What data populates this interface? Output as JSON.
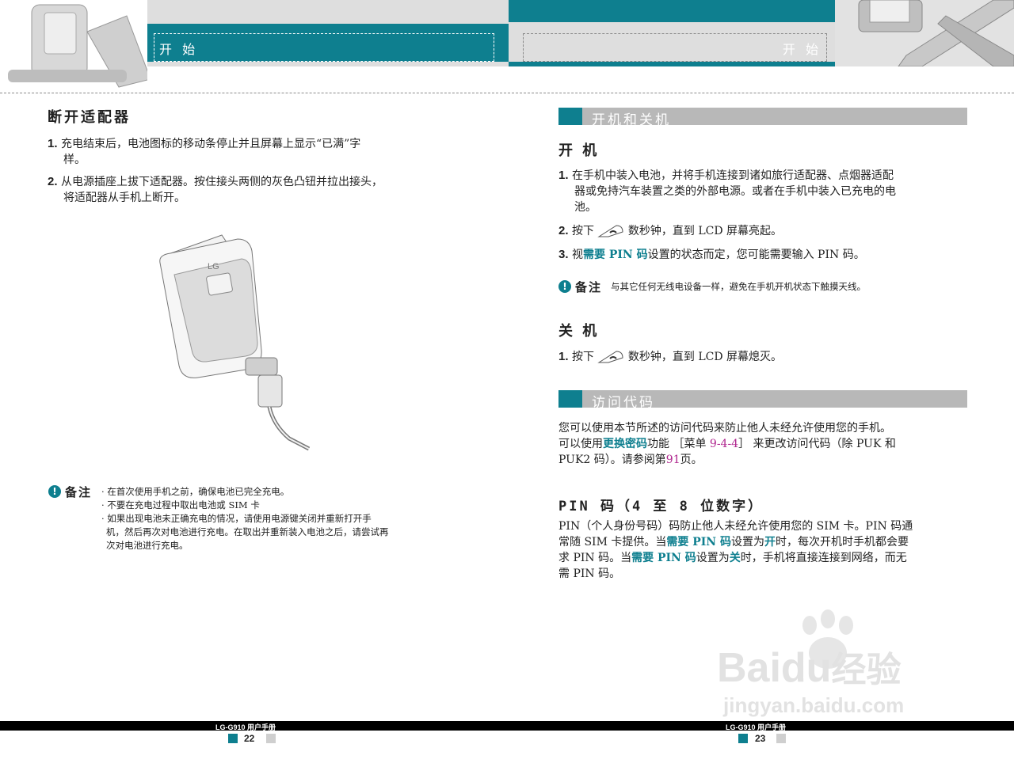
{
  "header": {
    "left_title": "开 始",
    "right_title": "开 始"
  },
  "left": {
    "heading": "断开适配器",
    "steps": [
      {
        "num": "1.",
        "text": "充电结束后，电池图标的移动条停止并且屏幕上显示“已满”字",
        "text2": "样。"
      },
      {
        "num": "2.",
        "text": "从电源插座上拔下适配器。按住接头两侧的灰色凸钮并拉出接头，",
        "text2": "将适配器从手机上断开。"
      }
    ],
    "phone_logo": "LG",
    "note_label": "备注",
    "note_lines": [
      "· 在首次使用手机之前，确保电池已完全充电。",
      "· 不要在充电过程中取出电池或 SIM 卡",
      "· 如果出现电池未正确充电的情况，请使用电源键关闭并重新打开手",
      "机，然后再次对电池进行充电。在取出并重新装入电池之后，请尝试再",
      "次对电池进行充电。"
    ]
  },
  "right": {
    "section1": "开机和关机",
    "power_on_heading": "开 机",
    "power_on_steps": {
      "s1_num": "1.",
      "s1_l1": "在手机中装入电池，并将手机连接到诸如旅行适配器、点烟器适配",
      "s1_l2": "器或免持汽车装置之类的外部电源。或者在手机中装入已充电的电",
      "s1_l3": "池。",
      "s2_num": "2.",
      "s2_a": "按下",
      "s2_b": "数秒钟，直到 LCD 屏幕亮起。",
      "s3_num": "3.",
      "s3_a": "视",
      "s3_hl": "需要 PIN 码",
      "s3_b": "设置的状态而定，您可能需要输入 PIN 码。"
    },
    "note_label": "备注",
    "note_text": "与其它任何无线电设备一样，避免在手机开机状态下触摸天线。",
    "power_off_heading": "关 机",
    "power_off_step": {
      "num": "1.",
      "a": "按下",
      "b": "数秒钟，直到 LCD 屏幕熄灭。"
    },
    "section2": "访问代码",
    "access": {
      "l1": "您可以使用本节所述的访问代码来防止他人未经允许使用您的手机。",
      "l2_a": "可以使用",
      "l2_hl": "更换密码",
      "l2_b": "功能 ［菜单 ",
      "l2_menu": "9-4-4",
      "l2_c": "］ 来更改访问代码（除 PUK 和",
      "l3_a": "PUK2 码）。请参阅第",
      "l3_pg": "91",
      "l3_b": "页。"
    },
    "pin_heading": "PIN 码（4 至 8 位数字）",
    "pin": {
      "l1": "PIN（个人身份号码）码防止他人未经允许使用您的 SIM 卡。PIN 码通",
      "l2_a": "常随 SIM 卡提供。当",
      "l2_hl": "需要 PIN 码",
      "l2_b": "设置为",
      "l2_on": "开",
      "l2_c": "时，每次开机时手机都会要",
      "l3_a": "求 PIN 码。当",
      "l3_hl": "需要 PIN 码",
      "l3_b": "设置为",
      "l3_off": "关",
      "l3_c": "时，手机将直接连接到网络，而无",
      "l4": "需 PIN 码。"
    }
  },
  "footer": {
    "left_manual": "LG-G910 用户手册",
    "left_page": "22",
    "right_manual": "LG-G910 用户手册",
    "right_page": "23"
  },
  "watermark": {
    "brand_a": "Bai",
    "brand_b": "du",
    "brand_c": "经验",
    "url": "jingyan.baidu.com"
  },
  "colors": {
    "accent": "#0e7f8f",
    "link": "#b0278f",
    "bar": "#b8b8b8"
  }
}
